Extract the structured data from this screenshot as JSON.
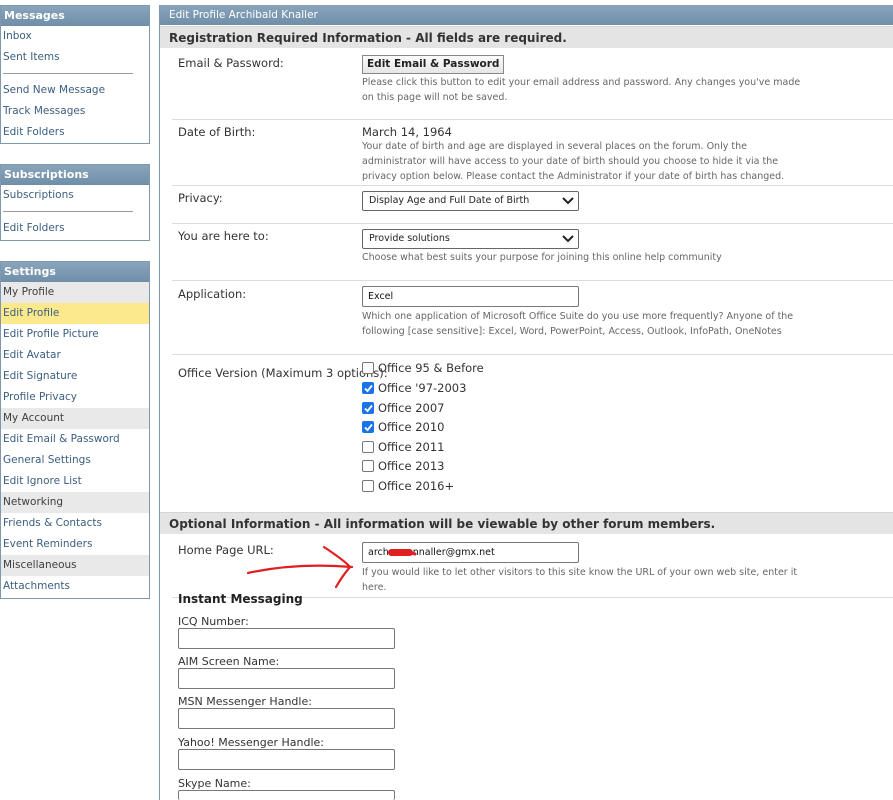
{
  "sidebar": {
    "messages": {
      "title": "Messages",
      "items": [
        "Inbox",
        "Sent Items",
        "Send New Message",
        "Track Messages",
        "Edit Folders"
      ]
    },
    "subscriptions": {
      "title": "Subscriptions",
      "items": [
        "Subscriptions",
        "Edit Folders"
      ]
    },
    "settings": {
      "title": "Settings",
      "groups": [
        "My Profile",
        "My Account",
        "Networking",
        "Miscellaneous"
      ],
      "items": [
        "Edit Profile",
        "Edit Profile Picture",
        "Edit Avatar",
        "Edit Signature",
        "Profile Privacy",
        "Edit Email & Password",
        "General Settings",
        "Edit Ignore List",
        "Friends & Contacts",
        "Event Reminders",
        "Attachments"
      ]
    }
  },
  "main": {
    "title": "Edit Profile Archibald Knaller",
    "required_header": "Registration Required Information - All fields are required.",
    "optional_header": "Optional Information - All information will be viewable by other forum members.",
    "email": {
      "label": "Email & Password:",
      "button": "Edit Email & Password",
      "hint": "Please click this button to edit your email address and password. Any changes you've made on this page will not be saved."
    },
    "dob": {
      "label": "Date of Birth:",
      "value": "March 14, 1964",
      "hint": "Your date of birth and age are displayed in several places on the forum. Only the administrator will have access to your date of birth should you choose to hide it via the privacy option below. Please contact the Administrator if your date of birth has changed."
    },
    "privacy": {
      "label": "Privacy:",
      "selected": "Display Age and Full Date of Birth"
    },
    "purpose": {
      "label": "You are here to:",
      "selected": "Provide solutions",
      "hint": "Choose what best suits your purpose for joining this online help community"
    },
    "application": {
      "label": "Application:",
      "value": "Excel",
      "hint": "Which one application of Microsoft Office Suite do you use more frequently? Anyone of the following [case sensitive]: Excel, Word, PowerPoint, Access, Outlook, InfoPath, OneNotes"
    },
    "office_version": {
      "label": "Office Version (Maximum 3 options):",
      "options": [
        {
          "label": "Office 95 & Before",
          "checked": false
        },
        {
          "label": "Office '97-2003",
          "checked": true
        },
        {
          "label": "Office 2007",
          "checked": true
        },
        {
          "label": "Office 2010",
          "checked": true
        },
        {
          "label": "Office 2011",
          "checked": false
        },
        {
          "label": "Office 2013",
          "checked": false
        },
        {
          "label": "Office 2016+",
          "checked": false
        }
      ]
    },
    "homepage": {
      "label": "Home Page URL:",
      "value_start": "arch",
      "value_end": "nnaller@gmx.net",
      "hint": "If you would like to let other visitors to this site know the URL of your own web site, enter it here."
    },
    "im": {
      "title": "Instant Messaging",
      "fields": [
        "ICQ Number:",
        "AIM Screen Name:",
        "MSN Messenger Handle:",
        "Yahoo! Messenger Handle:",
        "Skype Name:"
      ]
    }
  },
  "colors": {
    "header_blue": "#7f98ad",
    "active_item": "#fce98e",
    "annotation_red": "#e02020",
    "checkbox_blue": "#1a73e8"
  }
}
